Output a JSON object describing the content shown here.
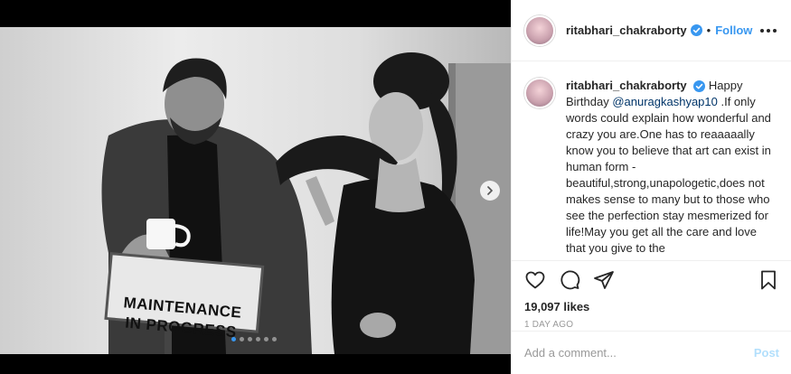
{
  "post": {
    "username": "ritabhari_chakraborty",
    "follow_label": "Follow",
    "separator": "•",
    "caption_mention": "@anuragkashyap10",
    "caption_before": "Happy Birthday ",
    "caption_after": " .If only words could explain how wonderful and crazy you are.One has to reaaaaally know you to believe that art can exist in human form - beautiful,strong,unapologetic,does not makes sense to many but to those who see the perfection stay mesmerized for life!May you get all the care and love that you give to the",
    "likes": "19,097 likes",
    "time_ago": "1 DAY AGO",
    "comment_placeholder": "Add a comment...",
    "post_label": "Post"
  },
  "photo": {
    "sign_line1": "MAINTENANCE",
    "sign_line2": "IN PROGRESS",
    "carousel_total": 6,
    "carousel_active": 1
  },
  "colors": {
    "accent": "#3897f0",
    "link": "#003569",
    "post_disabled": "#b2dffc"
  }
}
